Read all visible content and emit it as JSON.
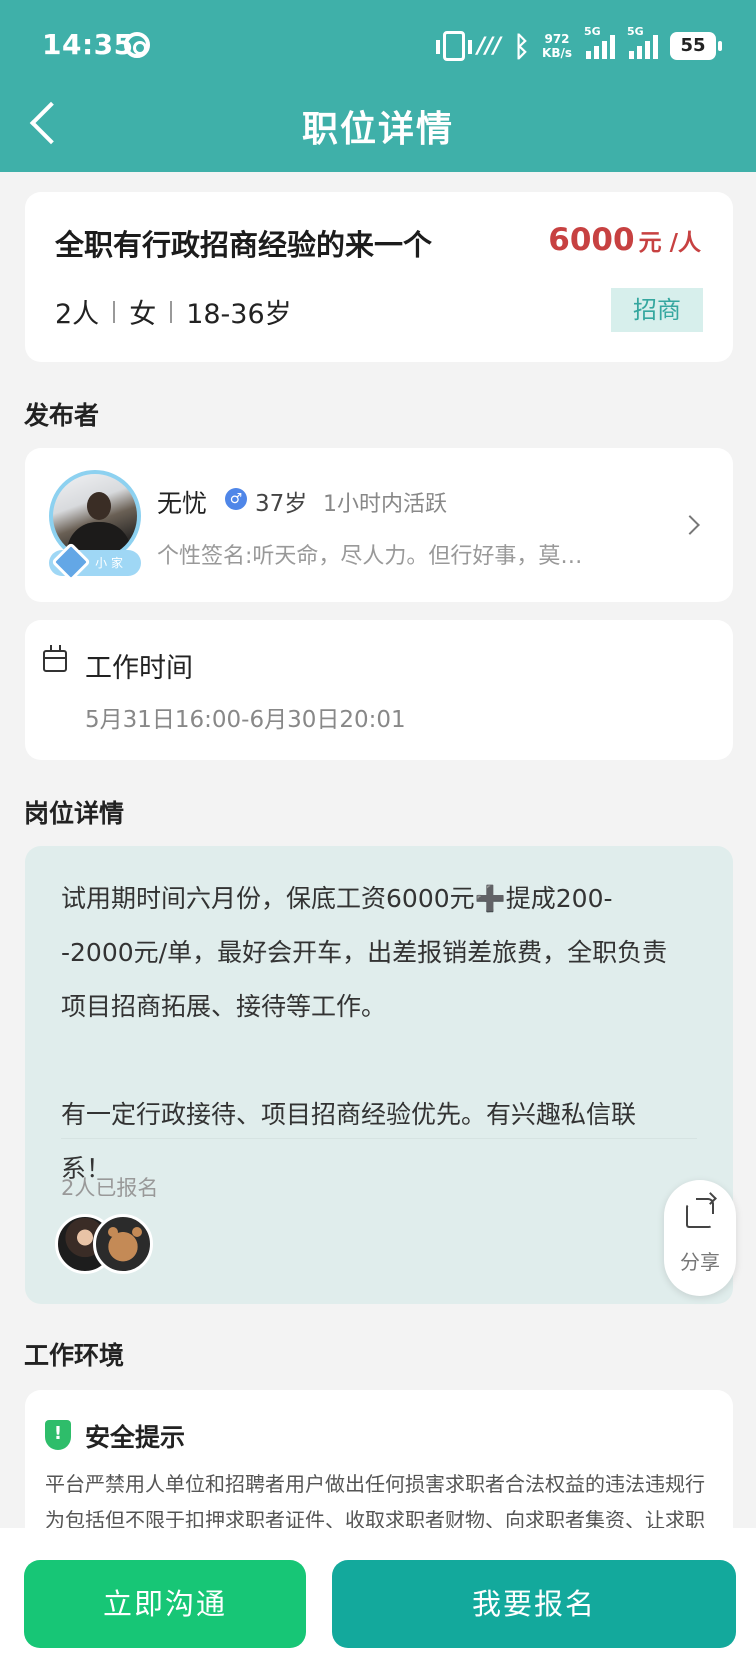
{
  "status_bar": {
    "time": "14:35",
    "net_speed_value": "972",
    "net_speed_unit": "KB/s",
    "network1": "5G",
    "network2": "5G",
    "battery": "55"
  },
  "header": {
    "title": "职位详情"
  },
  "job": {
    "title": "全职有行政招商经验的来一个",
    "salary_amount": "6000",
    "salary_unit": "元 /人",
    "headcount": "2人",
    "gender": "女",
    "age_range": "18-36岁",
    "tag": "招商"
  },
  "sections": {
    "publisher": "发布者",
    "job_detail": "岗位详情",
    "environment": "工作环境"
  },
  "publisher": {
    "name": "无忧",
    "gender_symbol": "♂",
    "age": "37岁",
    "active": "1小时内活跃",
    "signature": "个性签名:听天命，尽人力。但行好事，莫…",
    "badge": "小 家"
  },
  "work_time": {
    "label": "工作时间",
    "value": "5月31日16:00-6月30日20:01"
  },
  "job_detail": {
    "paragraph1": "试用期时间六月份，保底工资6000元➕提成200--2000元/单，最好会开车，出差报销差旅费，全职负责项目招商拓展、接待等工作。",
    "paragraph2": "有一定行政接待、项目招商经验优先。有兴趣私信联系！",
    "signed_up": "2人已报名"
  },
  "share": {
    "label": "分享"
  },
  "safety": {
    "title": "安全提示",
    "text": "平台严禁用人单位和招聘者用户做出任何损害求职者合法权益的违法违规行为包括但不限于扣押求职者证件、收取求职者财物、向求职者集资、让求职"
  },
  "actions": {
    "chat": "立即沟通",
    "apply": "我要报名"
  },
  "colors": {
    "header": "#3fb0a9",
    "salary": "#c74141",
    "chat_button": "#17c676",
    "apply_button": "#13a99c"
  }
}
